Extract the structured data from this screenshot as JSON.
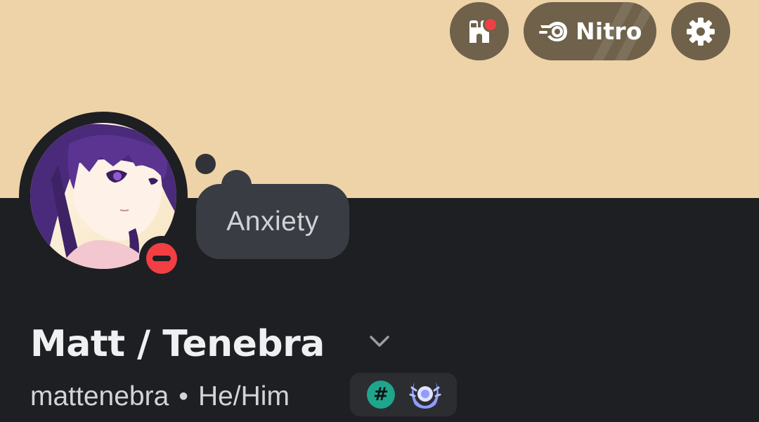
{
  "profile": {
    "display_name": "Matt / Tenebra",
    "username": "mattenebra",
    "separator": "•",
    "pronouns": "He/Him",
    "custom_status": "Anxiety",
    "presence": "do-not-disturb",
    "avatar_icon": "avatar-anime-girl-purple-hair"
  },
  "header": {
    "nitro_label": "Nitro",
    "shop_icon": "shop-icon",
    "settings_icon": "gear-icon",
    "has_shop_notification": true
  },
  "badges": [
    {
      "icon": "hashtag-badge-icon"
    },
    {
      "icon": "laurel-badge-icon"
    }
  ],
  "colors": {
    "banner": "#eed3a8",
    "button_bg": "#6f614a",
    "background": "#1e1f22",
    "status_dnd": "#f23f43",
    "badge_hash": "#1fa58c",
    "badge_laurel": "#8f9bff"
  }
}
